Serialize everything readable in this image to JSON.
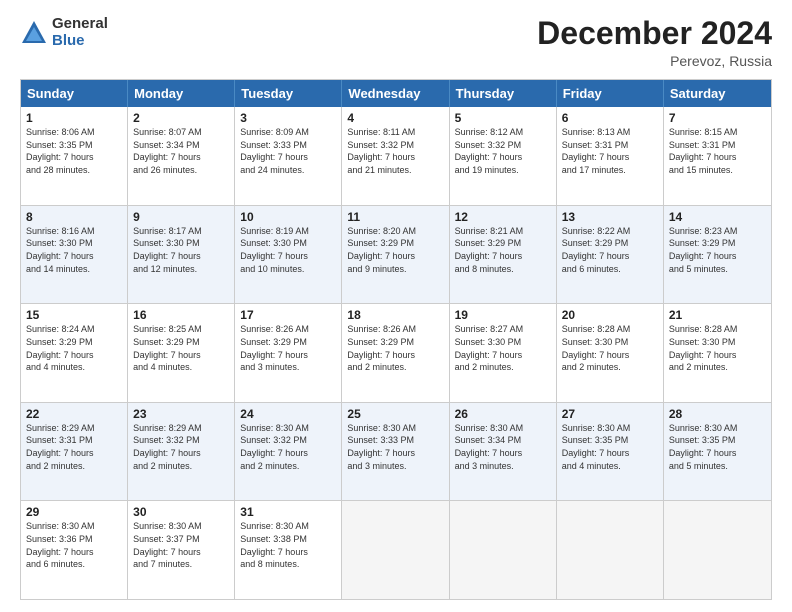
{
  "logo": {
    "general": "General",
    "blue": "Blue"
  },
  "title": "December 2024",
  "location": "Perevoz, Russia",
  "days_of_week": [
    "Sunday",
    "Monday",
    "Tuesday",
    "Wednesday",
    "Thursday",
    "Friday",
    "Saturday"
  ],
  "weeks": [
    [
      {
        "day": "1",
        "sunrise": "8:06 AM",
        "sunset": "3:35 PM",
        "daylight": "7 hours and 28 minutes."
      },
      {
        "day": "2",
        "sunrise": "8:07 AM",
        "sunset": "3:34 PM",
        "daylight": "7 hours and 26 minutes."
      },
      {
        "day": "3",
        "sunrise": "8:09 AM",
        "sunset": "3:33 PM",
        "daylight": "7 hours and 24 minutes."
      },
      {
        "day": "4",
        "sunrise": "8:11 AM",
        "sunset": "3:32 PM",
        "daylight": "7 hours and 21 minutes."
      },
      {
        "day": "5",
        "sunrise": "8:12 AM",
        "sunset": "3:32 PM",
        "daylight": "7 hours and 19 minutes."
      },
      {
        "day": "6",
        "sunrise": "8:13 AM",
        "sunset": "3:31 PM",
        "daylight": "7 hours and 17 minutes."
      },
      {
        "day": "7",
        "sunrise": "8:15 AM",
        "sunset": "3:31 PM",
        "daylight": "7 hours and 15 minutes."
      }
    ],
    [
      {
        "day": "8",
        "sunrise": "8:16 AM",
        "sunset": "3:30 PM",
        "daylight": "7 hours and 14 minutes."
      },
      {
        "day": "9",
        "sunrise": "8:17 AM",
        "sunset": "3:30 PM",
        "daylight": "7 hours and 12 minutes."
      },
      {
        "day": "10",
        "sunrise": "8:19 AM",
        "sunset": "3:30 PM",
        "daylight": "7 hours and 10 minutes."
      },
      {
        "day": "11",
        "sunrise": "8:20 AM",
        "sunset": "3:29 PM",
        "daylight": "7 hours and 9 minutes."
      },
      {
        "day": "12",
        "sunrise": "8:21 AM",
        "sunset": "3:29 PM",
        "daylight": "7 hours and 8 minutes."
      },
      {
        "day": "13",
        "sunrise": "8:22 AM",
        "sunset": "3:29 PM",
        "daylight": "7 hours and 6 minutes."
      },
      {
        "day": "14",
        "sunrise": "8:23 AM",
        "sunset": "3:29 PM",
        "daylight": "7 hours and 5 minutes."
      }
    ],
    [
      {
        "day": "15",
        "sunrise": "8:24 AM",
        "sunset": "3:29 PM",
        "daylight": "7 hours and 4 minutes."
      },
      {
        "day": "16",
        "sunrise": "8:25 AM",
        "sunset": "3:29 PM",
        "daylight": "7 hours and 4 minutes."
      },
      {
        "day": "17",
        "sunrise": "8:26 AM",
        "sunset": "3:29 PM",
        "daylight": "7 hours and 3 minutes."
      },
      {
        "day": "18",
        "sunrise": "8:26 AM",
        "sunset": "3:29 PM",
        "daylight": "7 hours and 2 minutes."
      },
      {
        "day": "19",
        "sunrise": "8:27 AM",
        "sunset": "3:30 PM",
        "daylight": "7 hours and 2 minutes."
      },
      {
        "day": "20",
        "sunrise": "8:28 AM",
        "sunset": "3:30 PM",
        "daylight": "7 hours and 2 minutes."
      },
      {
        "day": "21",
        "sunrise": "8:28 AM",
        "sunset": "3:30 PM",
        "daylight": "7 hours and 2 minutes."
      }
    ],
    [
      {
        "day": "22",
        "sunrise": "8:29 AM",
        "sunset": "3:31 PM",
        "daylight": "7 hours and 2 minutes."
      },
      {
        "day": "23",
        "sunrise": "8:29 AM",
        "sunset": "3:32 PM",
        "daylight": "7 hours and 2 minutes."
      },
      {
        "day": "24",
        "sunrise": "8:30 AM",
        "sunset": "3:32 PM",
        "daylight": "7 hours and 2 minutes."
      },
      {
        "day": "25",
        "sunrise": "8:30 AM",
        "sunset": "3:33 PM",
        "daylight": "7 hours and 3 minutes."
      },
      {
        "day": "26",
        "sunrise": "8:30 AM",
        "sunset": "3:34 PM",
        "daylight": "7 hours and 3 minutes."
      },
      {
        "day": "27",
        "sunrise": "8:30 AM",
        "sunset": "3:35 PM",
        "daylight": "7 hours and 4 minutes."
      },
      {
        "day": "28",
        "sunrise": "8:30 AM",
        "sunset": "3:35 PM",
        "daylight": "7 hours and 5 minutes."
      }
    ],
    [
      {
        "day": "29",
        "sunrise": "8:30 AM",
        "sunset": "3:36 PM",
        "daylight": "7 hours and 6 minutes."
      },
      {
        "day": "30",
        "sunrise": "8:30 AM",
        "sunset": "3:37 PM",
        "daylight": "7 hours and 7 minutes."
      },
      {
        "day": "31",
        "sunrise": "8:30 AM",
        "sunset": "3:38 PM",
        "daylight": "7 hours and 8 minutes."
      },
      null,
      null,
      null,
      null
    ]
  ]
}
